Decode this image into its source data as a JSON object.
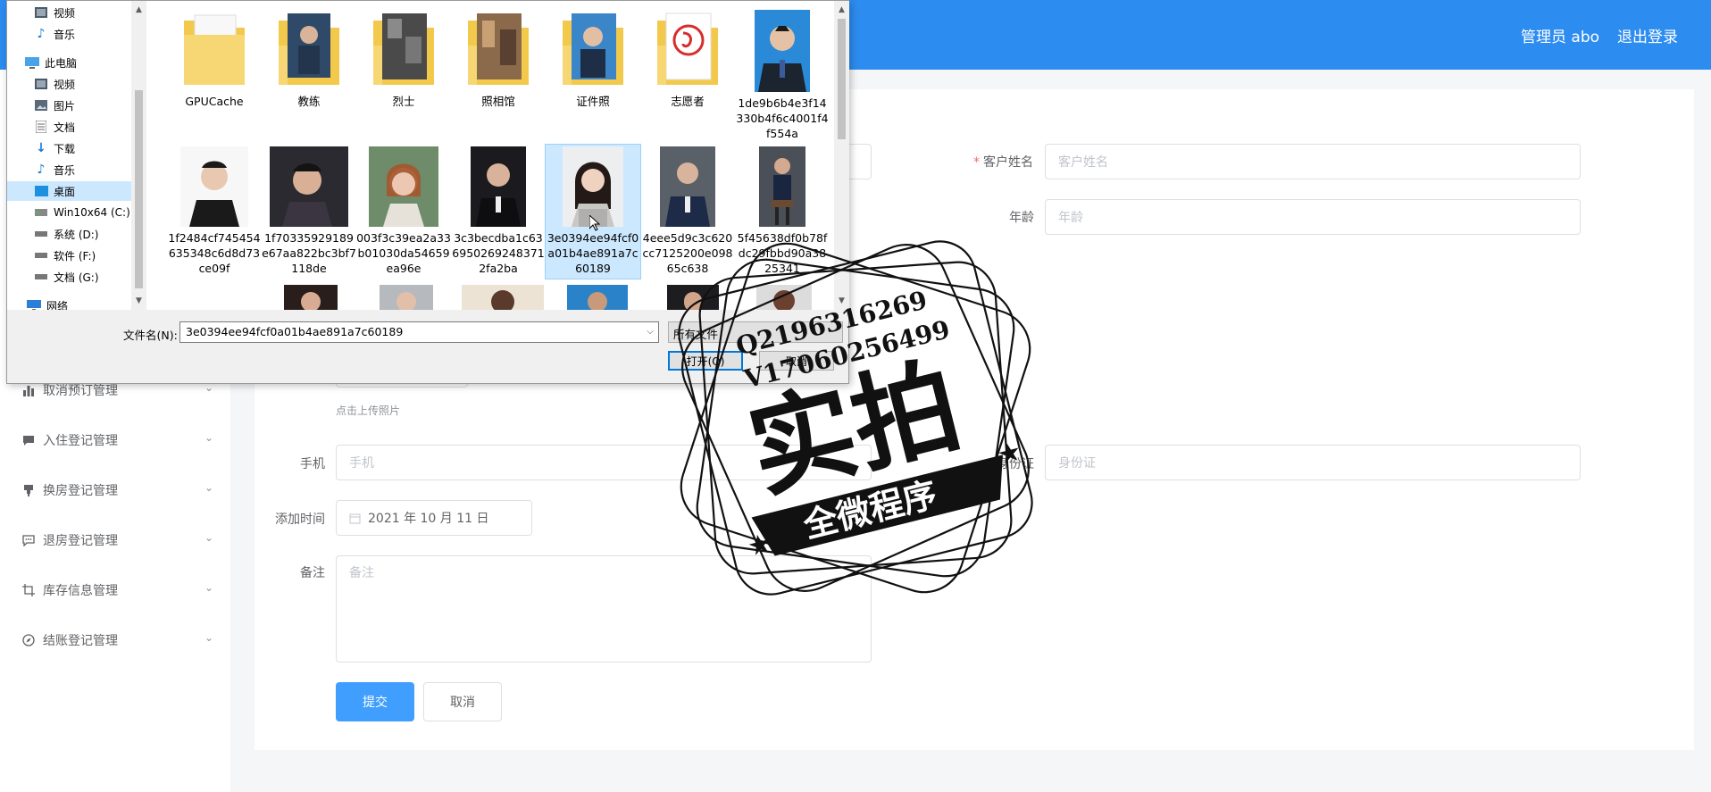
{
  "header": {
    "user_label": "管理员 abo",
    "logout_label": "退出登录",
    "accent_color": "#2d8cf0"
  },
  "sidebar": {
    "items": [
      {
        "label": "取消预订管理",
        "icon": "bar-chart-icon"
      },
      {
        "label": "入住登记管理",
        "icon": "chat-icon"
      },
      {
        "label": "换房登记管理",
        "icon": "stamp-icon"
      },
      {
        "label": "退房登记管理",
        "icon": "message-dots-icon"
      },
      {
        "label": "库存信息管理",
        "icon": "crop-icon"
      },
      {
        "label": "结账登记管理",
        "icon": "compass-icon"
      }
    ]
  },
  "form": {
    "customer_name_label": "客户姓名",
    "customer_name_placeholder": "客户姓名",
    "age_label": "年龄",
    "age_placeholder": "年龄",
    "upload_hint": "点击上传照片",
    "phone_label": "手机",
    "phone_placeholder": "手机",
    "id_label": "身份证",
    "id_placeholder": "身份证",
    "added_time_label": "添加时间",
    "added_time_value": "2021 年 10 月 11 日",
    "remarks_label": "备注",
    "remarks_placeholder": "备注",
    "submit_label": "提交",
    "cancel_label": "取消"
  },
  "file_dialog": {
    "nav": [
      {
        "label": "视频",
        "icon": "video-folder-icon"
      },
      {
        "label": "音乐",
        "icon": "music-icon"
      },
      {
        "label": "此电脑",
        "icon": "computer-icon"
      },
      {
        "label": "视频",
        "icon": "video-folder-icon"
      },
      {
        "label": "图片",
        "icon": "pictures-folder-icon"
      },
      {
        "label": "文档",
        "icon": "documents-folder-icon"
      },
      {
        "label": "下载",
        "icon": "download-icon"
      },
      {
        "label": "音乐",
        "icon": "music-icon"
      },
      {
        "label": "桌面",
        "icon": "desktop-icon"
      },
      {
        "label": "Win10x64 (C:)",
        "icon": "drive-icon"
      },
      {
        "label": "系统 (D:)",
        "icon": "drive-icon"
      },
      {
        "label": "软件 (F:)",
        "icon": "drive-icon"
      },
      {
        "label": "文档 (G:)",
        "icon": "drive-icon"
      },
      {
        "label": "网络",
        "icon": "network-icon"
      }
    ],
    "row1": [
      {
        "label": "GPUCache",
        "kind": "folder"
      },
      {
        "label": "教练",
        "kind": "folder"
      },
      {
        "label": "烈士",
        "kind": "folder"
      },
      {
        "label": "照相馆",
        "kind": "folder"
      },
      {
        "label": "证件照",
        "kind": "folder"
      },
      {
        "label": "志愿者",
        "kind": "folder"
      },
      {
        "label": "1de9b6b4e3f14330b4f6c4001f4f554a",
        "kind": "photo"
      }
    ],
    "row2": [
      {
        "label": "1f2484cf745454635348c6d8d73ce09f",
        "kind": "photo"
      },
      {
        "label": "1f70335929189e67aa822bc3bf7118de",
        "kind": "photo"
      },
      {
        "label": "003f3c39ea2a33b01030da54659ea96e",
        "kind": "photo"
      },
      {
        "label": "3c3becdba1c636950269248371 2fa2ba",
        "kind": "photo"
      },
      {
        "label": "3e0394ee94fcf0a01b4ae891a7c60189",
        "kind": "photo"
      },
      {
        "label": "4eee5d9c3c620cc7125200e09865c638",
        "kind": "photo"
      },
      {
        "label": "5f45638df0b78fdc29fbbd90a3825341",
        "kind": "photo"
      }
    ],
    "filename_label": "文件名(N):",
    "filename_value": "3e0394ee94fcf0a01b4ae891a7c60189",
    "filetype_value": "所有文件",
    "open_label": "打开(O)",
    "cancel_label": "取消"
  },
  "watermark": {
    "line1": "Q2196316269",
    "line2": "V17060256499",
    "main": "实拍",
    "banner": "全微程序"
  }
}
